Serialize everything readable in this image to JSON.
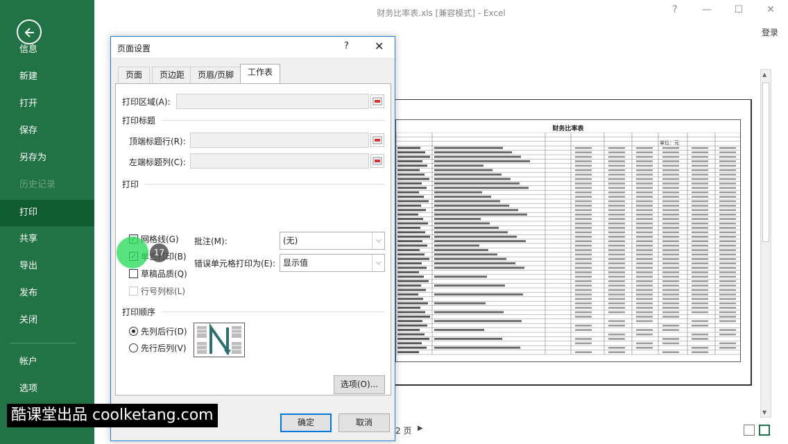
{
  "window": {
    "title": "财务比率表.xls  [兼容模式] - Excel",
    "login": "登录",
    "help": "?",
    "minimize": "—",
    "restore": "☐",
    "close": "✕"
  },
  "sidebar": {
    "items": [
      {
        "label": "信息"
      },
      {
        "label": "新建"
      },
      {
        "label": "打开"
      },
      {
        "label": "保存"
      },
      {
        "label": "另存为"
      },
      {
        "label": "历史记录"
      },
      {
        "label": "打印"
      },
      {
        "label": "共享"
      },
      {
        "label": "导出"
      },
      {
        "label": "发布"
      },
      {
        "label": "关闭"
      },
      {
        "label": "帐户"
      },
      {
        "label": "选项"
      }
    ],
    "active": "打印",
    "disabled": "历史记录"
  },
  "dialog": {
    "title": "页面设置",
    "help": "?",
    "close": "✕",
    "tabs": [
      {
        "label": "页面"
      },
      {
        "label": "页边距"
      },
      {
        "label": "页眉/页脚"
      },
      {
        "label": "工作表"
      }
    ],
    "active_tab": "工作表",
    "print_area_label": "打印区域(A):",
    "print_titles_label": "打印标题",
    "rows_repeat_label": "顶端标题行(R):",
    "cols_repeat_label": "左端标题列(C):",
    "print_label": "打印",
    "gridlines_label": "网格线(G)",
    "gridlines_checked": true,
    "bw_label": "单色打印(B)",
    "bw_checked": true,
    "draft_label": "草稿品质(Q)",
    "draft_checked": false,
    "headings_label": "行号列标(L)",
    "headings_checked": false,
    "comments_label": "批注(M):",
    "comments_value": "(无)",
    "errors_label": "错误单元格打印为(E):",
    "errors_value": "显示值",
    "order_label": "打印顺序",
    "down_over_label": "先列后行(D)",
    "over_down_label": "先行后列(V)",
    "selected_order": "先列后行(D)",
    "options_button": "选项(O)...",
    "ok_button": "确定",
    "cancel_button": "取消"
  },
  "preview": {
    "sheet_title": "财务比率表",
    "unit_label": "单位：元",
    "page_count": "2 页",
    "next_arrow": "▶"
  },
  "step_badge": "17",
  "watermark": "酷课堂出品 coolketang.com"
}
